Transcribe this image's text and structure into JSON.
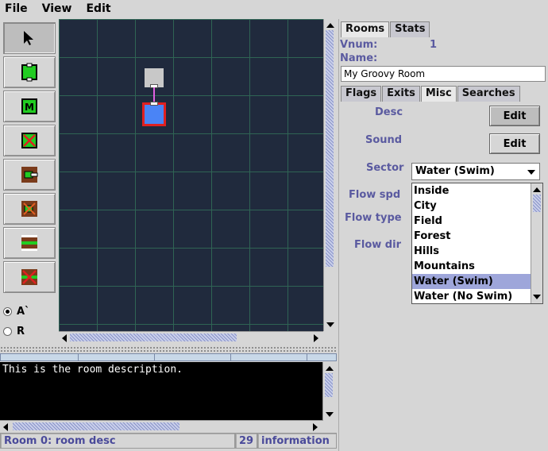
{
  "menu": {
    "file": "File",
    "view": "View",
    "edit": "Edit"
  },
  "toolbar": {
    "tools": [
      "select-arrow",
      "new-room",
      "new-mob",
      "delete-room",
      "new-exit",
      "delete-exit",
      "link-exit",
      "unlink-exit"
    ],
    "radio_a": "A`",
    "radio_r": "R"
  },
  "description": {
    "text": "This is the room description."
  },
  "status": {
    "room": "Room 0: room desc",
    "number": "29",
    "info": "information"
  },
  "panel": {
    "tabs": [
      "Rooms",
      "Stats"
    ],
    "vnum_label": "Vnum:",
    "vnum_value": "1",
    "name_label": "Name:",
    "name_value": "My Groovy Room",
    "subtabs": [
      "Flags",
      "Exits",
      "Misc",
      "Searches"
    ],
    "desc_label": "Desc",
    "desc_button": "Edit",
    "sound_label": "Sound",
    "sound_button": "Edit",
    "sector_label": "Sector",
    "sector_value": "Water (Swim)",
    "flow_spd_label": "Flow spd",
    "flow_type_label": "Flow type",
    "flow_dir_label": "Flow dir",
    "sector_options": [
      "Inside",
      "City",
      "Field",
      "Forest",
      "Hills",
      "Mountains",
      "Water (Swim)",
      "Water (No Swim)"
    ]
  },
  "colors": {
    "map_bg": "#202a3d",
    "grid": "#2f6454",
    "room_selected": "#4a84f6",
    "room_border": "#e02020",
    "label": "#5a5aa0"
  }
}
